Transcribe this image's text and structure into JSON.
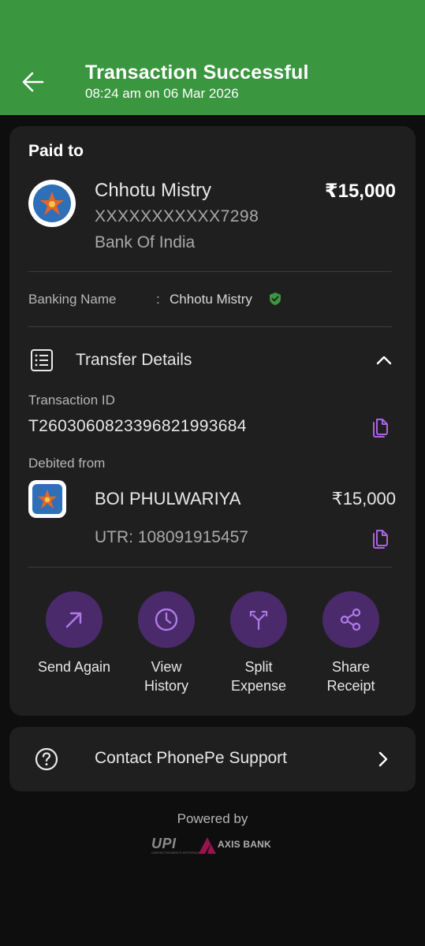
{
  "header": {
    "title": "Transaction Successful",
    "subtitle": "08:24 am on 06 Mar 2026",
    "background_color": "#3a963f"
  },
  "paid_to": {
    "heading": "Paid to",
    "name": "Chhotu Mistry",
    "account": "XXXXXXXXXXX7298",
    "bank": "Bank Of India",
    "amount": "₹15,000",
    "logo_icon": "bank-of-india-star-logo"
  },
  "banking_name": {
    "label": "Banking Name",
    "colon": ":",
    "value": "Chhotu Mistry",
    "verified_icon": "verified-shield-icon"
  },
  "transfer_details": {
    "label": "Transfer Details",
    "expanded": true,
    "transaction_id_label": "Transaction ID",
    "transaction_id": "T2603060823396821993684",
    "debited_from_label": "Debited from",
    "debit_bank": "BOI PHULWARIYA",
    "debit_amount": "₹15,000",
    "utr": "UTR: 108091915457"
  },
  "actions": [
    {
      "label": "Send Again",
      "icon": "arrow-up-right-icon"
    },
    {
      "label": "View\nHistory",
      "icon": "clock-icon"
    },
    {
      "label": "Split\nExpense",
      "icon": "split-icon"
    },
    {
      "label": "Share\nReceipt",
      "icon": "share-icon"
    }
  ],
  "support": {
    "label": "Contact PhonePe Support",
    "icon": "help-circle-icon"
  },
  "footer": {
    "powered_by": "Powered by",
    "upi_logo_text": "UPI",
    "upi_logo_subtext": "UNIFIED PAYMENTS INTERFACE",
    "axis_logo_text": "AXIS BANK"
  },
  "colors": {
    "accent_purple": "#a764e6",
    "action_circle": "#4a2a6b",
    "card_bg": "#1f1f1f",
    "page_bg": "#0e0e0e",
    "verified_green": "#3a963f",
    "axis_maroon": "#97144d"
  }
}
